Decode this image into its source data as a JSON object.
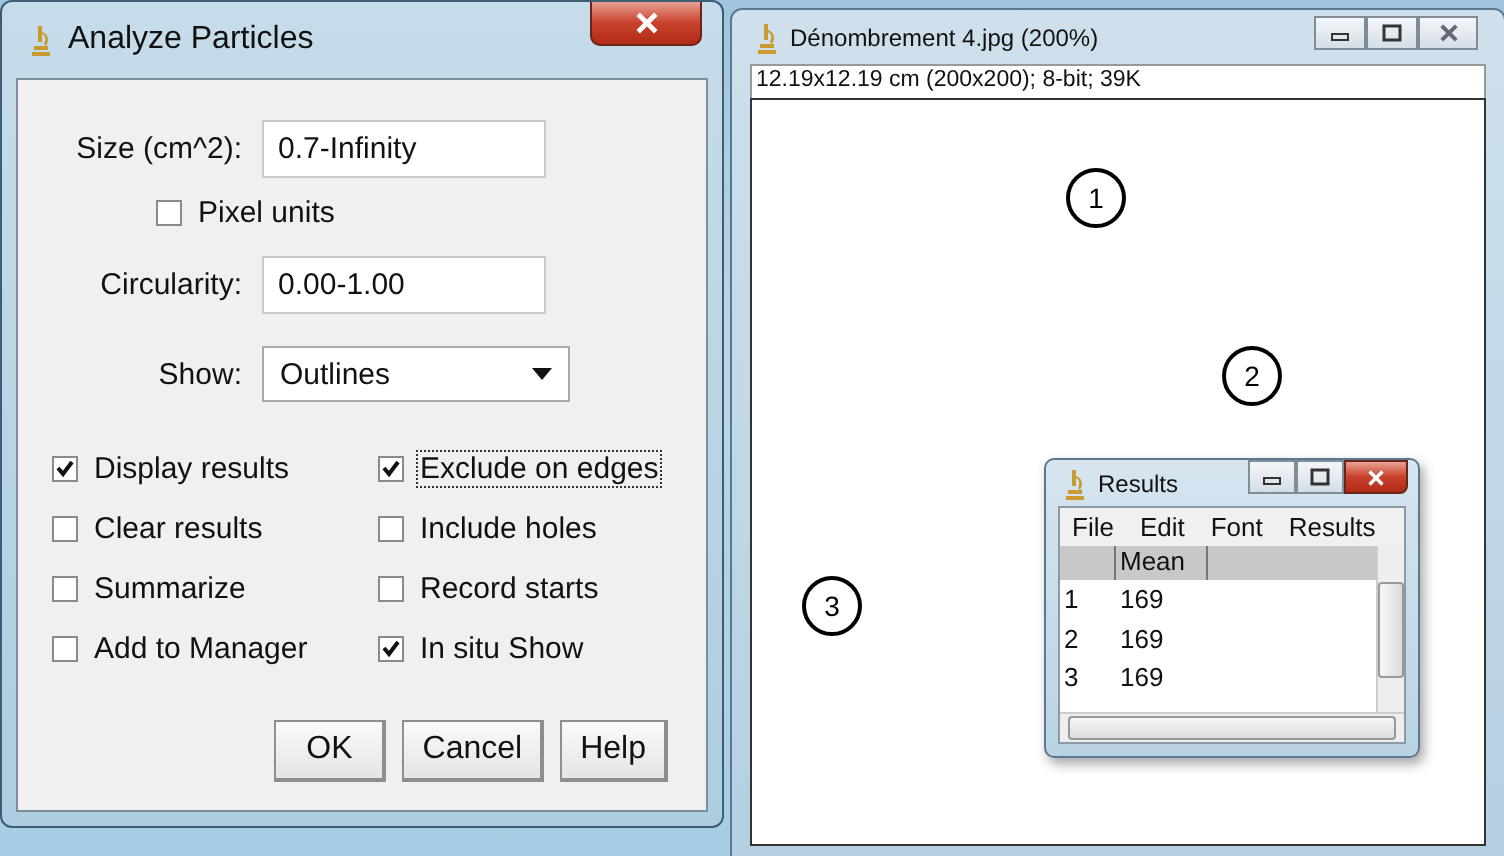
{
  "dialog": {
    "title": "Analyze Particles",
    "fields": [
      {
        "label": "Size (cm^2):",
        "value": "0.7-Infinity"
      }
    ],
    "pixel_units": {
      "label": "Pixel units",
      "checked": false
    },
    "fields_2": [
      {
        "label": "Circularity:",
        "value": "0.00-1.00"
      }
    ],
    "show": {
      "label": "Show:",
      "value": "Outlines"
    },
    "options": [
      {
        "label": "Display results",
        "checked": true,
        "focused": false
      },
      {
        "label": "Exclude on edges",
        "checked": true,
        "focused": true
      },
      {
        "label": "Clear results",
        "checked": false,
        "focused": false
      },
      {
        "label": "Include holes",
        "checked": false,
        "focused": false
      },
      {
        "label": "Summarize",
        "checked": false,
        "focused": false
      },
      {
        "label": "Record starts",
        "checked": false,
        "focused": false
      },
      {
        "label": "Add to Manager",
        "checked": false,
        "focused": false
      },
      {
        "label": "In situ Show",
        "checked": true,
        "focused": false
      }
    ],
    "buttons": [
      "OK",
      "Cancel",
      "Help"
    ]
  },
  "image_window": {
    "title": "Dénombrement 4.jpg (200%)",
    "info": "12.19x12.19 cm (200x200); 8-bit; 39K",
    "particles": [
      {
        "label": "1"
      },
      {
        "label": "2"
      },
      {
        "label": "3"
      }
    ]
  },
  "results": {
    "title": "Results",
    "menu": [
      "File",
      "Edit",
      "Font",
      "Results"
    ],
    "columns": [
      "Mean"
    ],
    "rows": [
      {
        "index": "1",
        "mean": "169"
      },
      {
        "index": "2",
        "mean": "169"
      },
      {
        "index": "3",
        "mean": "169"
      }
    ]
  }
}
